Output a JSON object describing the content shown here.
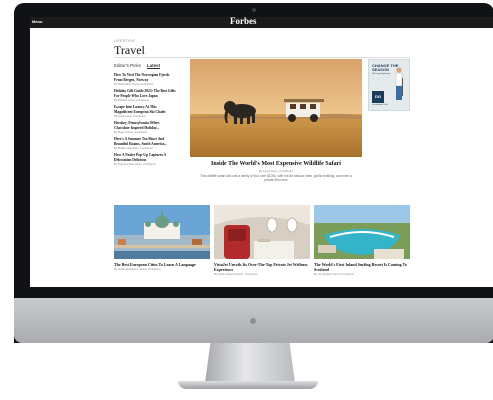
{
  "site": {
    "menu_label": "Menu",
    "logo": "Forbes"
  },
  "page": {
    "kicker": "LIFESTYLE",
    "title": "Travel"
  },
  "sidebar": {
    "tabs": [
      "Editor's Picks",
      "Latest"
    ],
    "stories": [
      {
        "title": "How To Visit The Norwegian Fjords From Bergen, Norway",
        "by": "By David Nikel, Senior Contributor"
      },
      {
        "title": "Holiday Gift Guide 2023: The Best Gifts For People Who Love Japan",
        "by": "By Michelle Gross, Contributor"
      },
      {
        "title": "Escape Into Luxury At This Magnificent European Ski Chalet",
        "by": "By Angie Licea, Contributor"
      },
      {
        "title": "Hershey, Pennsylvania Offers Chocolate-Inspired Holiday...",
        "by": "By Roger Sands, Contributor"
      },
      {
        "title": "Here's A Summer Too Short And Beautiful Roams, South America...",
        "by": "By Bradley Hartmann, Contributor"
      },
      {
        "title": "How A Native Pop-Up Captures A Delectation Delicious",
        "by": "By Angelina Villa-Clarke, Contributor"
      }
    ]
  },
  "hero": {
    "title": "Inside The World's Most Expensive Wildlife Safari",
    "by": "By Lewis Nunn, Contributor",
    "desc": "This wildlife safari will cost a family of four over $100k, with hot air balloon rides, gorilla trekking, and even a private film crew."
  },
  "ad": {
    "headline": "CHANGE THE SEASON",
    "sub": "Gift a golf getaway",
    "logo": "DG",
    "brand": "Destination Golf"
  },
  "cards": [
    {
      "title": "The Best European Cities To Learn A Language",
      "by": "By Cecilia Rodriguez, Senior Contributor"
    },
    {
      "title": "VistaJet Unveils Its Over-The-Top Private Jet Wellness Experience",
      "by": "By Jacob Jaques Redlich, Contributor"
    },
    {
      "title": "The World's First Inland Surfing Resort Is Coming To Scotland",
      "by": "By Jon Ackland, Senior Contributor"
    }
  ],
  "colors": {
    "topbar": "#1b1b1b",
    "ad_accent": "#1a3c59"
  }
}
